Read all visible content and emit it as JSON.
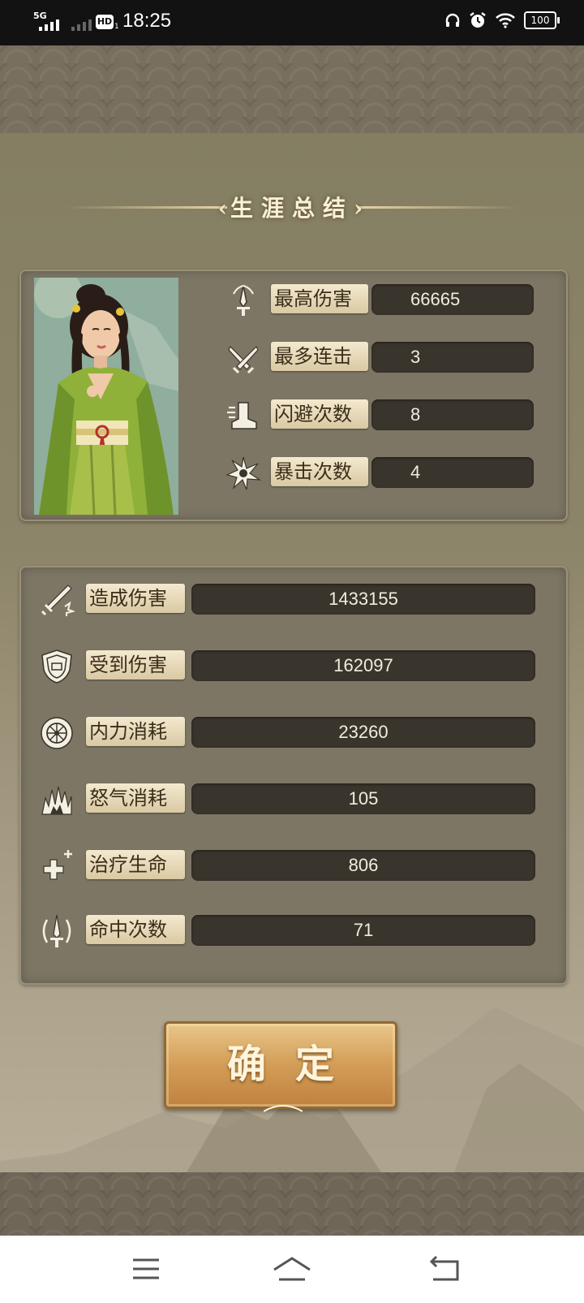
{
  "status_bar": {
    "network": "5G",
    "hd": "HD",
    "hd_sub": "1",
    "time": "18:25",
    "battery": "100"
  },
  "title": "生涯总结",
  "title_left_mark": "‹",
  "title_right_mark": "›",
  "highlights": [
    {
      "label": "最高伤害",
      "value": "66665",
      "icon": "sword-icon"
    },
    {
      "label": "最多连击",
      "value": "3",
      "icon": "crossed-blades-icon"
    },
    {
      "label": "闪避次数",
      "value": "8",
      "icon": "boot-icon"
    },
    {
      "label": "暴击次数",
      "value": "4",
      "icon": "burst-icon"
    }
  ],
  "stats": [
    {
      "label": "造成伤害",
      "value": "1433155",
      "icon": "sword-strike-icon"
    },
    {
      "label": "受到伤害",
      "value": "162097",
      "icon": "shield-icon"
    },
    {
      "label": "内力消耗",
      "value": "23260",
      "icon": "wheel-icon"
    },
    {
      "label": "怒气消耗",
      "value": "105",
      "icon": "rage-icon"
    },
    {
      "label": "治疗生命",
      "value": "806",
      "icon": "heal-cross-icon"
    },
    {
      "label": "命中次数",
      "value": "71",
      "icon": "target-sword-icon"
    }
  ],
  "confirm_label": "确定",
  "colors": {
    "value_bg": "#3a352c",
    "label_bg": "#f4e9cf",
    "button": "#d39d57"
  }
}
